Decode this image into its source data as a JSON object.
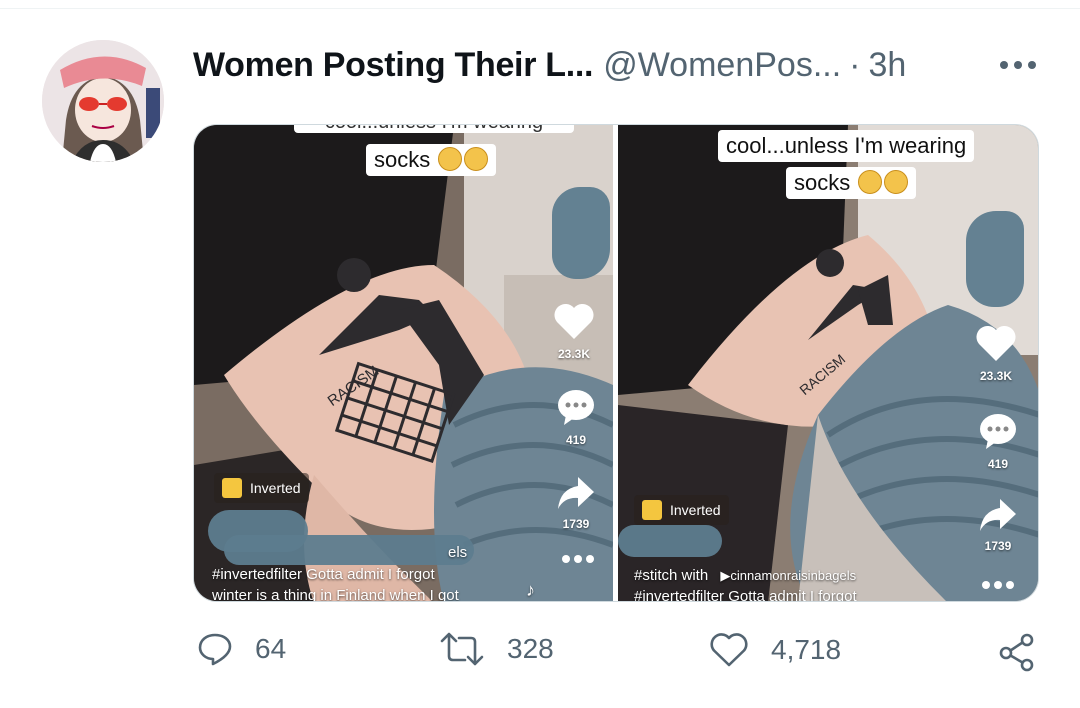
{
  "tweet": {
    "author_name": "Women Posting Their L...",
    "handle": "@WomenPos...",
    "separator": "·",
    "time": "3h"
  },
  "media": {
    "left": {
      "caption_top_cut": "cool...unless I'm wearing",
      "caption": "socks",
      "likes": "23.3K",
      "comments": "419",
      "shares": "1739",
      "badge": "Inverted",
      "tattoo_text": "RACISM",
      "desc_line1_end": "els",
      "desc_line2": "#invertedfilter Gotta admit I forgot",
      "desc_line3": "winter is a thing in Finland when I got"
    },
    "right": {
      "caption_line1": "cool...unless I'm wearing",
      "caption_line2": "socks",
      "likes": "23.3K",
      "comments": "419",
      "shares": "1739",
      "badge": "Inverted",
      "tattoo_text": "RACISM",
      "desc_line1_a": "#stitch with",
      "desc_line1_b": "▶cinnamonraisinbagels",
      "desc_line2": "#invertedfilter Gotta admit I forgot"
    }
  },
  "stats": {
    "replies": "64",
    "retweets": "328",
    "likes": "4,718"
  },
  "colors": {
    "text_primary": "#0f1419",
    "text_secondary": "#536471",
    "border": "#cfd9de",
    "redaction": "#5d7c8e"
  }
}
